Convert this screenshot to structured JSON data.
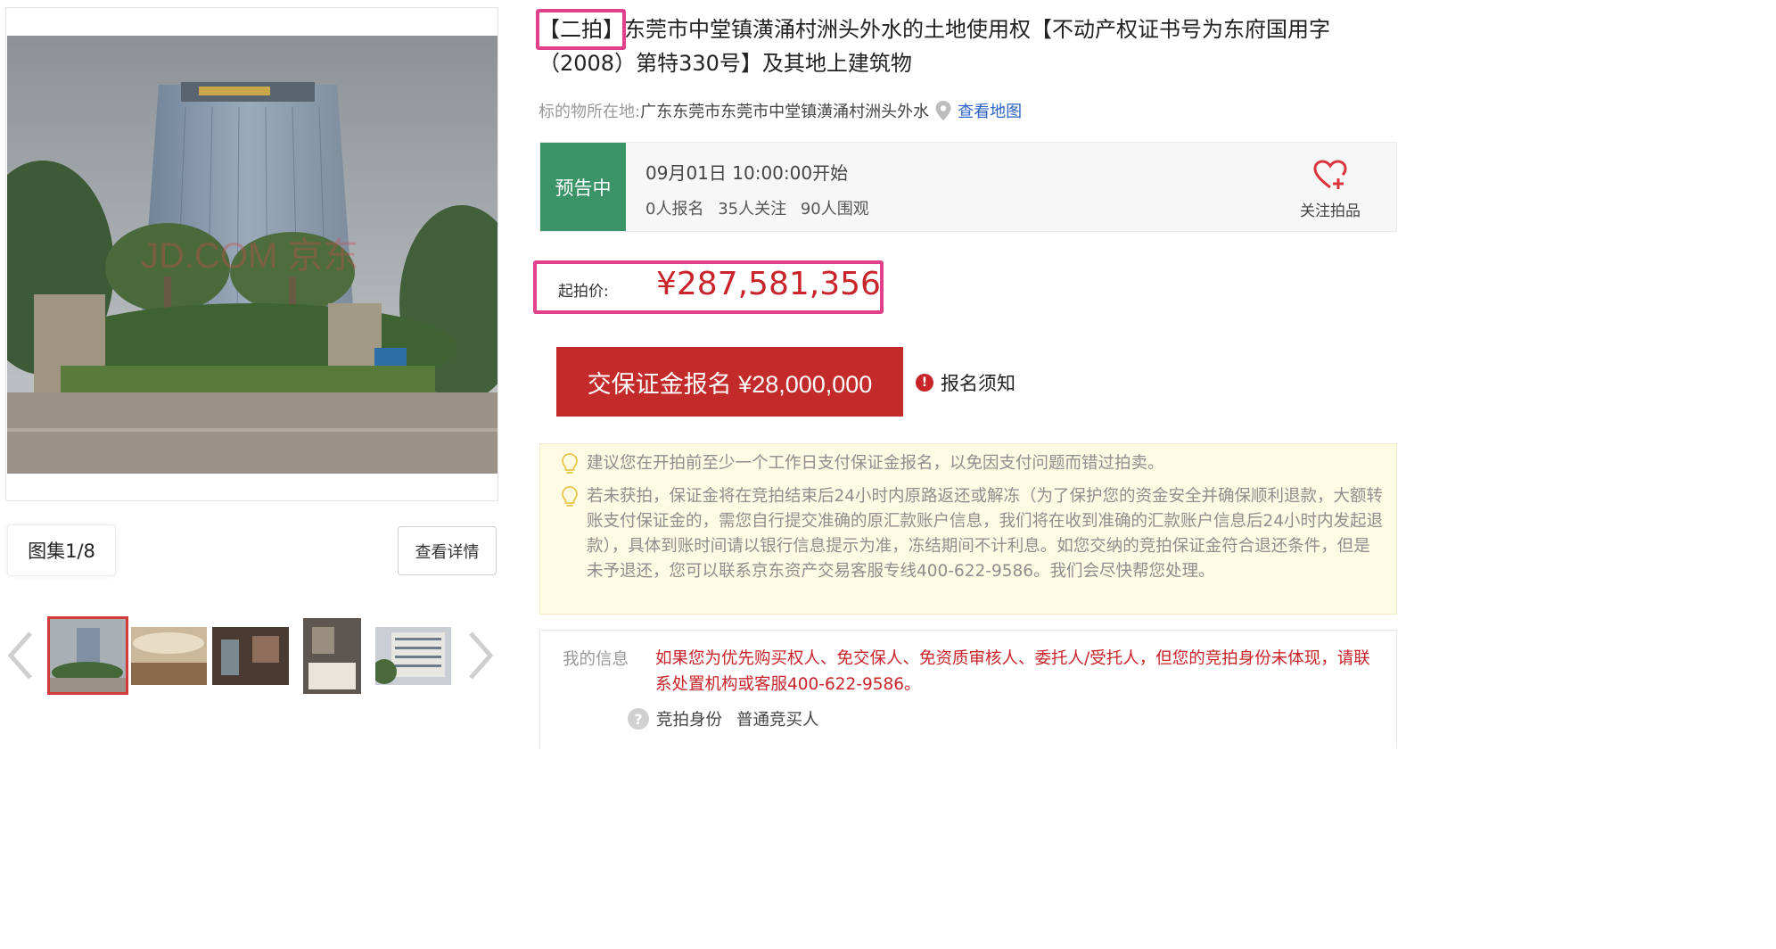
{
  "gallery": {
    "watermark": "JD.COM 京东",
    "counter": "图集1/8",
    "detail_label": "查看详情",
    "thumbnails": [
      "hotel-exterior",
      "lobby",
      "restaurant",
      "guest-room",
      "building-facade"
    ]
  },
  "listing": {
    "round_tag": "【二拍】",
    "title": "东莞市中堂镇潢涌村洲头外水的土地使用权【不动产权证书号为东府国用字（2008）第特330号】及其地上建筑物",
    "location_label": "标的物所在地:",
    "location_value": "广东东莞市东莞市中堂镇潢涌村洲头外水",
    "map_link": "查看地图"
  },
  "status": {
    "badge": "预告中",
    "start_time": "09月01日 10:00:00开始",
    "registered": "0人报名",
    "followers": "35人关注",
    "viewers": "90人围观",
    "follow_label": "关注拍品"
  },
  "price": {
    "label": "起拍价:",
    "value": "¥287,581,356"
  },
  "actions": {
    "deposit_button": "交保证金报名 ¥28,000,000",
    "notice_link": "报名须知"
  },
  "tips": [
    "建议您在开拍前至少一个工作日支付保证金报名，以免因支付问题而错过拍卖。",
    "若未获拍，保证金将在竞拍结束后24小时内原路返还或解冻（为了保护您的资金安全并确保顺利退款，大额转账支付保证金的，需您自行提交准确的原汇款账户信息，我们将在收到准确的汇款账户信息后24小时内发起退款），具体到账时间请以银行信息提示为准，冻结期间不计利息。如您交纳的竞拍保证金符合退还条件，但是未予退还，您可以联系京东资产交易客服专线400-622-9586。我们会尽快帮您处理。"
  ],
  "my_info": {
    "label": "我的信息",
    "message": "如果您为优先购买权人、免交保人、免资质审核人、委托人/受托人，但您的竞拍身份未体现，请联系处置机构或客服400-622-9586。",
    "identity_label": "竞拍身份",
    "identity_value": "普通竞买人"
  },
  "colors": {
    "accent_red": "#c32a2a",
    "price_red": "#c8242a",
    "status_green": "#3a9468",
    "highlight_pink": "#e0418a",
    "link_blue": "#2c64c8",
    "tips_bg": "#fdfbe3"
  }
}
